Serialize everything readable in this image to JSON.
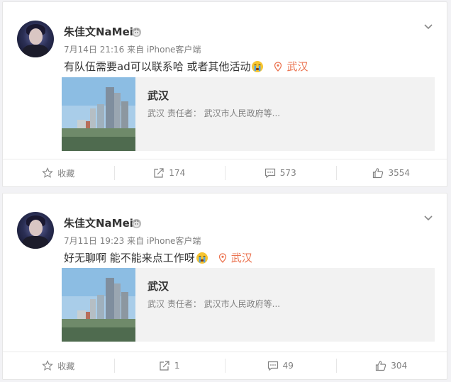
{
  "posts": [
    {
      "author": "朱佳文NaMei",
      "meta": "7月14日 21:16 来自 iPhone客户端",
      "text": "有队伍需要ad可以联系哈 或者其他活动",
      "location": "武汉",
      "link_card": {
        "title": "武汉",
        "desc": "武汉 责任者：  武汉市人民政府等..."
      },
      "actions": {
        "favorite": "收藏",
        "repost": "174",
        "comment": "573",
        "like": "3554"
      }
    },
    {
      "author": "朱佳文NaMei",
      "meta": "7月11日 19:23 来自 iPhone客户端",
      "text": "好无聊啊 能不能来点工作呀",
      "location": "武汉",
      "link_card": {
        "title": "武汉",
        "desc": "武汉 责任者：  武汉市人民政府等..."
      },
      "actions": {
        "favorite": "收藏",
        "repost": "1",
        "comment": "49",
        "like": "304"
      }
    }
  ],
  "colors": {
    "accent_location": "#eb7350",
    "meta_gray": "#808080"
  },
  "icons": [
    "avatar",
    "verified-badge-icon",
    "chevron-down-icon",
    "crying-emoji-icon",
    "location-pin-icon",
    "star-icon",
    "share-icon",
    "comment-icon",
    "thumbs-up-icon"
  ]
}
